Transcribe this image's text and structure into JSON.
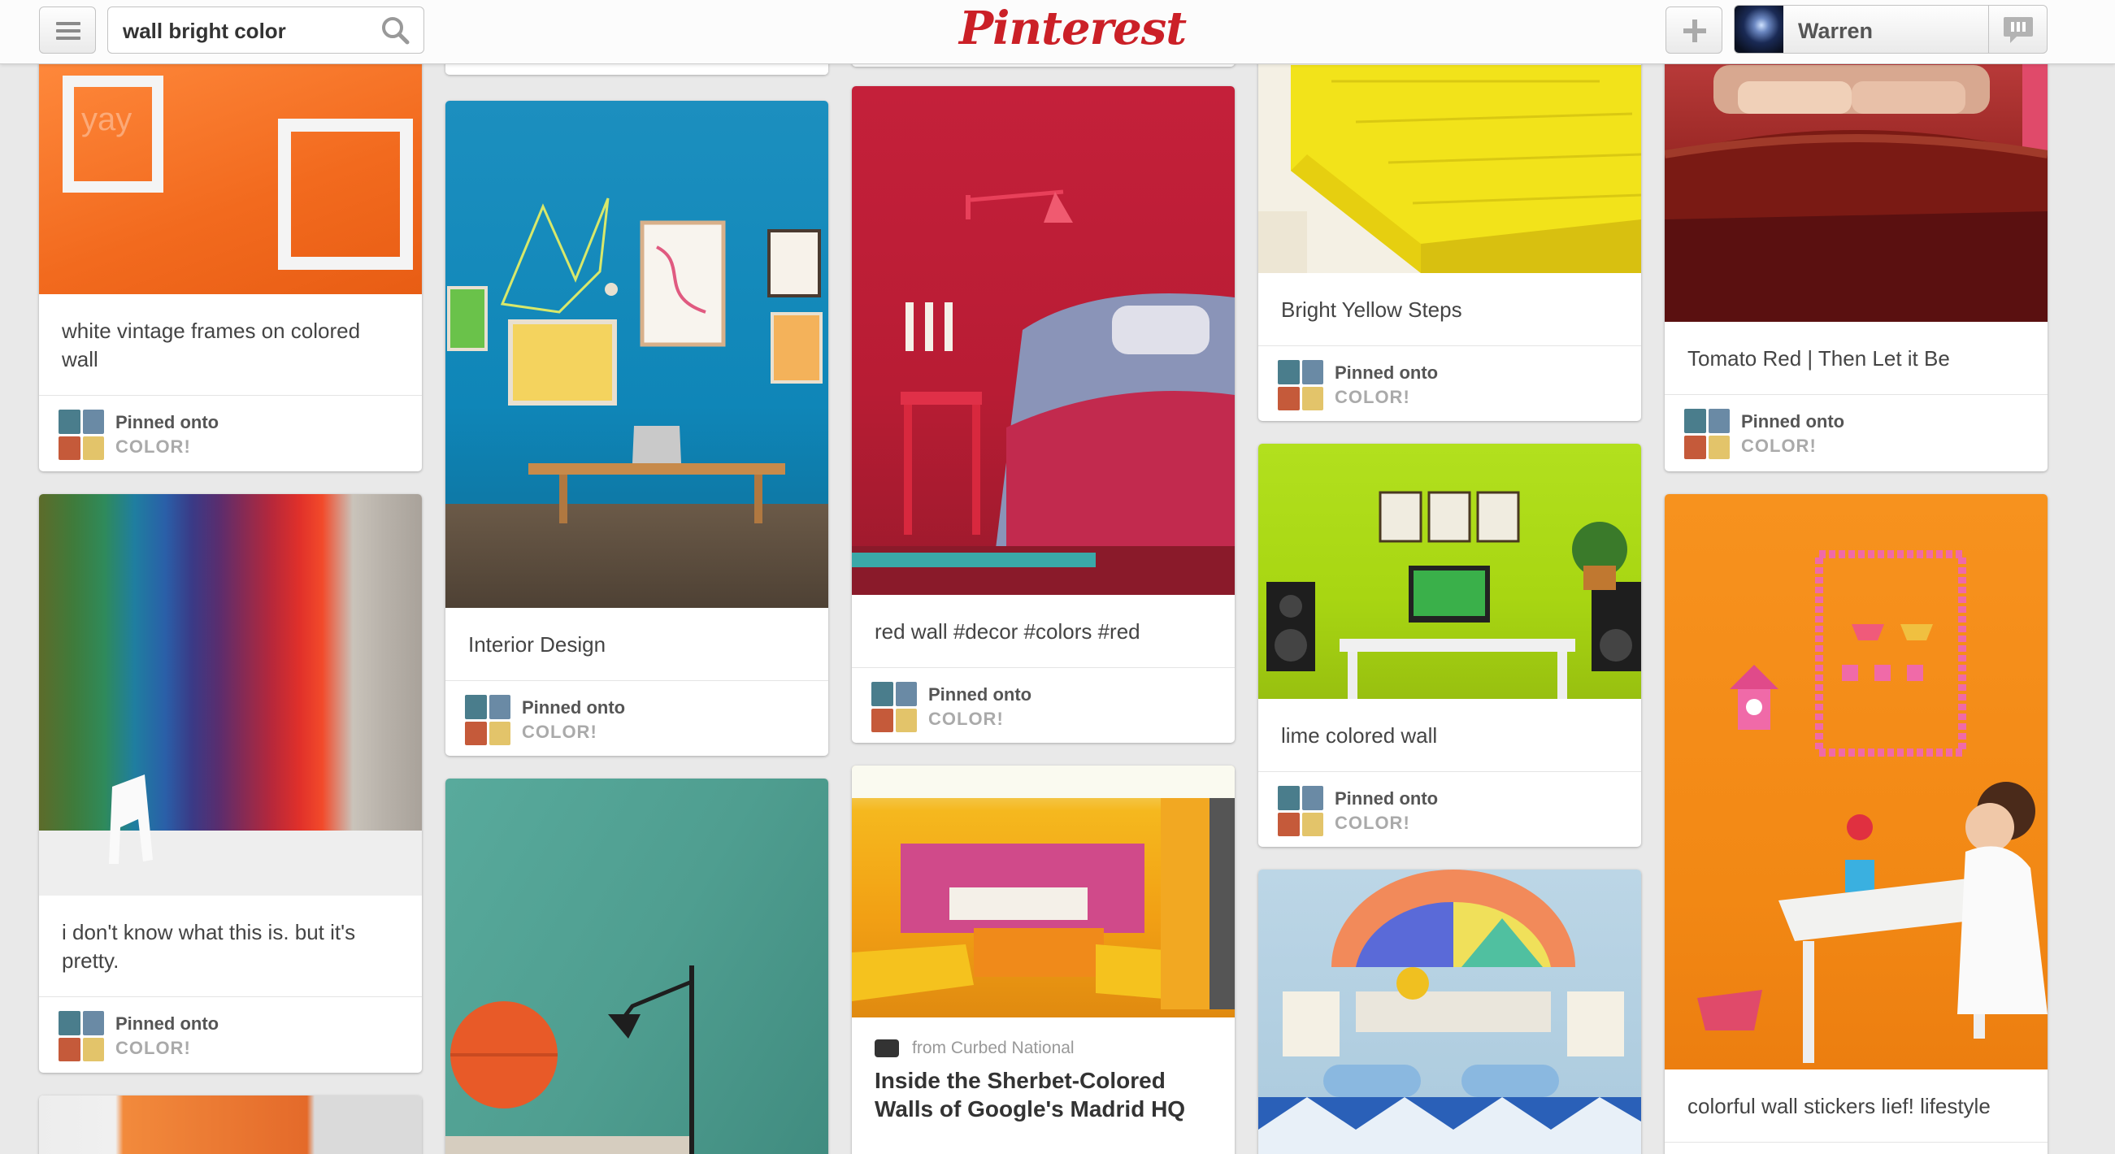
{
  "header": {
    "search_value": "wall bright color",
    "logo_text": "Pinterest",
    "username": "Warren"
  },
  "pinned_label": "Pinned onto",
  "board_name": "COLOR!",
  "columns": [
    {
      "pins": [
        {
          "description": "white vintage frames on colored wall",
          "image": "orange wall with white vintage frames"
        },
        {
          "description": "i don't know what this is. but it's pretty.",
          "image": "rainbow striped wall with white chair"
        }
      ]
    },
    {
      "pins": [
        {
          "description": "Interior Design",
          "image": "blue wall with bench and art"
        },
        {
          "image": "teal wall with orange circle and lamp"
        }
      ]
    },
    {
      "pins": [
        {
          "description": "red wall #decor #colors #red",
          "image": "red bedroom"
        },
        {
          "source": "from Curbed National",
          "description": "Inside the Sherbet-Colored Walls of Google's Madrid HQ",
          "image": "yellow orange meeting booth"
        }
      ]
    },
    {
      "pins": [
        {
          "description": "Bright Yellow Steps",
          "image": "yellow wooden steps"
        },
        {
          "description": "lime colored wall",
          "image": "lime green office wall"
        },
        {
          "image": "colorful living room with geometric art"
        }
      ]
    },
    {
      "pins": [
        {
          "description": "Tomato Red | Then Let it Be",
          "image": "red bedroom headboard"
        },
        {
          "description": "colorful wall stickers lief! lifestyle",
          "image": "orange wall with stickers and girl"
        }
      ]
    }
  ]
}
